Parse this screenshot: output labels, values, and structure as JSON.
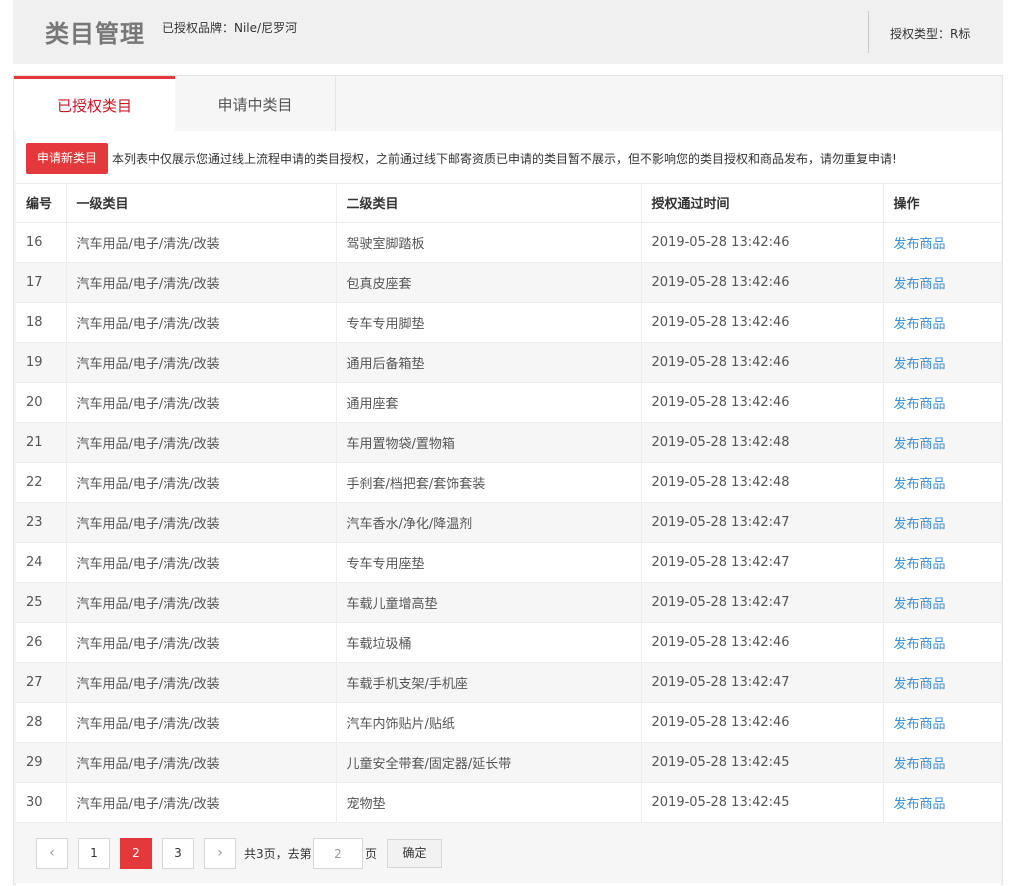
{
  "header": {
    "title": "类目管理",
    "brand_info": "已授权品牌：Nile/尼罗河",
    "auth_type": "授权类型：R标"
  },
  "tabs": [
    {
      "label": "已授权类目",
      "active": true
    },
    {
      "label": "申请中类目",
      "active": false
    }
  ],
  "notice": {
    "button_label": "申请新类目",
    "text": "本列表中仅展示您通过线上流程申请的类目授权，之前通过线下邮寄资质已申请的类目暂不展示，但不影响您的类目授权和商品发布，请勿重复申请!"
  },
  "table": {
    "headers": [
      "编号",
      "一级类目",
      "二级类目",
      "授权通过时间",
      "操作"
    ],
    "rows": [
      {
        "id": "16",
        "cat1": "汽车用品/电子/清洗/改装",
        "cat2": "驾驶室脚踏板",
        "time": "2019-05-28 13:42:46",
        "action": "发布商品"
      },
      {
        "id": "17",
        "cat1": "汽车用品/电子/清洗/改装",
        "cat2": "包真皮座套",
        "time": "2019-05-28 13:42:46",
        "action": "发布商品"
      },
      {
        "id": "18",
        "cat1": "汽车用品/电子/清洗/改装",
        "cat2": "专车专用脚垫",
        "time": "2019-05-28 13:42:46",
        "action": "发布商品"
      },
      {
        "id": "19",
        "cat1": "汽车用品/电子/清洗/改装",
        "cat2": "通用后备箱垫",
        "time": "2019-05-28 13:42:46",
        "action": "发布商品"
      },
      {
        "id": "20",
        "cat1": "汽车用品/电子/清洗/改装",
        "cat2": "通用座套",
        "time": "2019-05-28 13:42:46",
        "action": "发布商品"
      },
      {
        "id": "21",
        "cat1": "汽车用品/电子/清洗/改装",
        "cat2": "车用置物袋/置物箱",
        "time": "2019-05-28 13:42:48",
        "action": "发布商品"
      },
      {
        "id": "22",
        "cat1": "汽车用品/电子/清洗/改装",
        "cat2": "手刹套/档把套/套饰套装",
        "time": "2019-05-28 13:42:48",
        "action": "发布商品"
      },
      {
        "id": "23",
        "cat1": "汽车用品/电子/清洗/改装",
        "cat2": "汽车香水/净化/降温剂",
        "time": "2019-05-28 13:42:47",
        "action": "发布商品"
      },
      {
        "id": "24",
        "cat1": "汽车用品/电子/清洗/改装",
        "cat2": "专车专用座垫",
        "time": "2019-05-28 13:42:47",
        "action": "发布商品"
      },
      {
        "id": "25",
        "cat1": "汽车用品/电子/清洗/改装",
        "cat2": "车载儿童增高垫",
        "time": "2019-05-28 13:42:47",
        "action": "发布商品"
      },
      {
        "id": "26",
        "cat1": "汽车用品/电子/清洗/改装",
        "cat2": "车载垃圾桶",
        "time": "2019-05-28 13:42:46",
        "action": "发布商品"
      },
      {
        "id": "27",
        "cat1": "汽车用品/电子/清洗/改装",
        "cat2": "车载手机支架/手机座",
        "time": "2019-05-28 13:42:47",
        "action": "发布商品"
      },
      {
        "id": "28",
        "cat1": "汽车用品/电子/清洗/改装",
        "cat2": "汽车内饰贴片/贴纸",
        "time": "2019-05-28 13:42:46",
        "action": "发布商品"
      },
      {
        "id": "29",
        "cat1": "汽车用品/电子/清洗/改装",
        "cat2": "儿童安全带套/固定器/延长带",
        "time": "2019-05-28 13:42:45",
        "action": "发布商品"
      },
      {
        "id": "30",
        "cat1": "汽车用品/电子/清洗/改装",
        "cat2": "宠物垫",
        "time": "2019-05-28 13:42:45",
        "action": "发布商品"
      }
    ]
  },
  "pagination": {
    "prev_icon": "chevron-left-icon",
    "next_icon": "chevron-right-icon",
    "prev_glyph": "‹",
    "next_glyph": "›",
    "pages": [
      "1",
      "2",
      "3"
    ],
    "current": "2",
    "total_text": "共3页，去第",
    "input_value": "2",
    "page_suffix": "页",
    "confirm_label": "确定"
  },
  "colors": {
    "accent_red": "#e4393c",
    "link_blue": "#3a8fd6"
  }
}
